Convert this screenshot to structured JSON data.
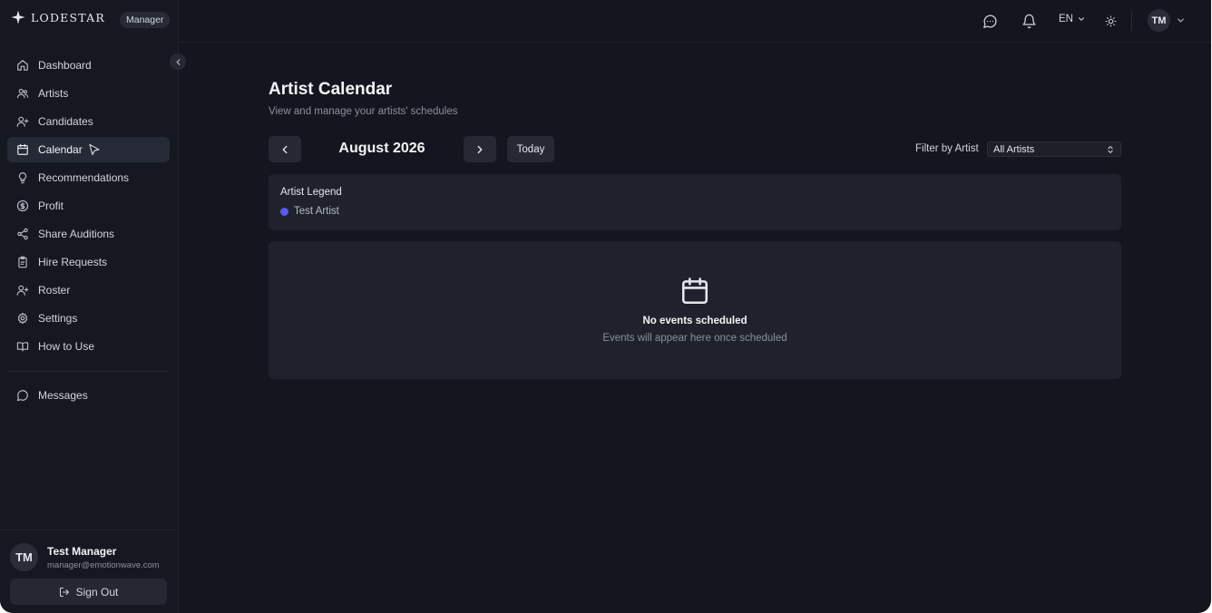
{
  "brand": {
    "name": "LODESTAR",
    "role": "Manager",
    "icon": "star-icon"
  },
  "sidebar": {
    "items": [
      {
        "label": "Dashboard",
        "icon": "home-icon",
        "active": false
      },
      {
        "label": "Artists",
        "icon": "artists-icon",
        "active": false
      },
      {
        "label": "Candidates",
        "icon": "user-plus-icon",
        "active": false
      },
      {
        "label": "Calendar",
        "icon": "calendar-icon",
        "active": true
      },
      {
        "label": "Recommendations",
        "icon": "lightbulb-icon",
        "active": false
      },
      {
        "label": "Profit",
        "icon": "dollar-icon",
        "active": false
      },
      {
        "label": "Share Auditions",
        "icon": "share-icon",
        "active": false
      },
      {
        "label": "Hire Requests",
        "icon": "clipboard-icon",
        "active": false
      },
      {
        "label": "Roster",
        "icon": "user-plus-icon",
        "active": false
      },
      {
        "label": "Settings",
        "icon": "gear-icon",
        "active": false
      },
      {
        "label": "How to Use",
        "icon": "book-icon",
        "active": false
      }
    ],
    "secondary": [
      {
        "label": "Messages",
        "icon": "message-icon"
      }
    ]
  },
  "user": {
    "initials": "TM",
    "name": "Test Manager",
    "email": "manager@emotionwave.com",
    "signout_label": "Sign Out"
  },
  "header": {
    "language": "EN",
    "initials": "TM"
  },
  "page": {
    "title": "Artist Calendar",
    "subtitle": "View and manage your artists' schedules"
  },
  "calendar": {
    "month_label": "August 2026",
    "today_label": "Today",
    "filter_label": "Filter by Artist",
    "filter_value": "All Artists"
  },
  "legend": {
    "title": "Artist Legend",
    "artists": [
      {
        "name": "Test Artist",
        "color": "#5b5bf0"
      }
    ]
  },
  "empty_state": {
    "title": "No events scheduled",
    "subtitle": "Events will appear here once scheduled"
  },
  "colors": {
    "background": "#14161f",
    "card": "#1f222d",
    "accent": "#5b5bf0"
  }
}
